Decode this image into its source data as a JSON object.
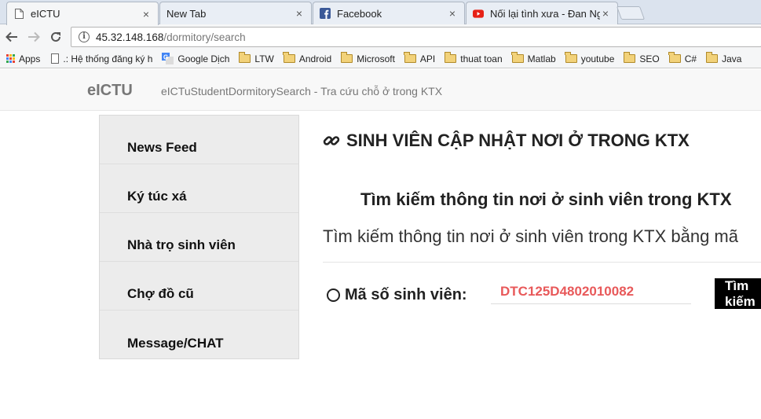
{
  "browser": {
    "tabs": [
      {
        "title": "eICTU",
        "icon": "page-icon",
        "active": true
      },
      {
        "title": "New Tab",
        "icon": "none",
        "active": false
      },
      {
        "title": "Facebook",
        "icon": "facebook-icon",
        "active": false
      },
      {
        "title": "Nối lại tình xưa - Đan Ng",
        "icon": "youtube-icon",
        "active": false
      }
    ],
    "close_glyph": "×",
    "url_host": "45.32.148.168",
    "url_path": "/dormitory/search",
    "bookmarks": [
      {
        "label": "Apps",
        "icon": "apps-grid-icon"
      },
      {
        "label": ".: Hệ thống đăng ký h",
        "icon": "page-icon"
      },
      {
        "label": "Google Dịch",
        "icon": "google-translate-icon"
      },
      {
        "label": "LTW",
        "icon": "folder-icon"
      },
      {
        "label": "Android",
        "icon": "folder-icon"
      },
      {
        "label": "Microsoft",
        "icon": "folder-icon"
      },
      {
        "label": "API",
        "icon": "folder-icon"
      },
      {
        "label": "thuat toan",
        "icon": "folder-icon"
      },
      {
        "label": "Matlab",
        "icon": "folder-icon"
      },
      {
        "label": "youtube",
        "icon": "folder-icon"
      },
      {
        "label": "SEO",
        "icon": "folder-icon"
      },
      {
        "label": "C#",
        "icon": "folder-icon"
      },
      {
        "label": "Java",
        "icon": "folder-icon"
      }
    ]
  },
  "header": {
    "brand": "eICTU",
    "tagline": "eICTuStudentDormitorySearch - Tra cứu chỗ ở trong KTX"
  },
  "sidebar": {
    "items": [
      {
        "label": "News Feed"
      },
      {
        "label": "Ký túc xá"
      },
      {
        "label": "Nhà trọ sinh viên"
      },
      {
        "label": "Chợ đồ cũ"
      },
      {
        "label": "Message/CHAT"
      }
    ]
  },
  "main": {
    "title": "SINH VIÊN CẬP NHẬT NƠI Ở TRONG KTX",
    "search_heading": "Tìm kiếm thông tin nơi ở sinh viên trong KTX",
    "search_sub": "Tìm kiếm thông tin nơi ở sinh viên trong KTX bằng mã",
    "field_label": "Mã số sinh viên:",
    "student_id_value": "DTC125D4802010082",
    "search_button": "Tìm kiếm"
  },
  "colors": {
    "accent_input_text": "#e8595a",
    "button_bg": "#000000",
    "sidebar_bg": "#ececec"
  }
}
